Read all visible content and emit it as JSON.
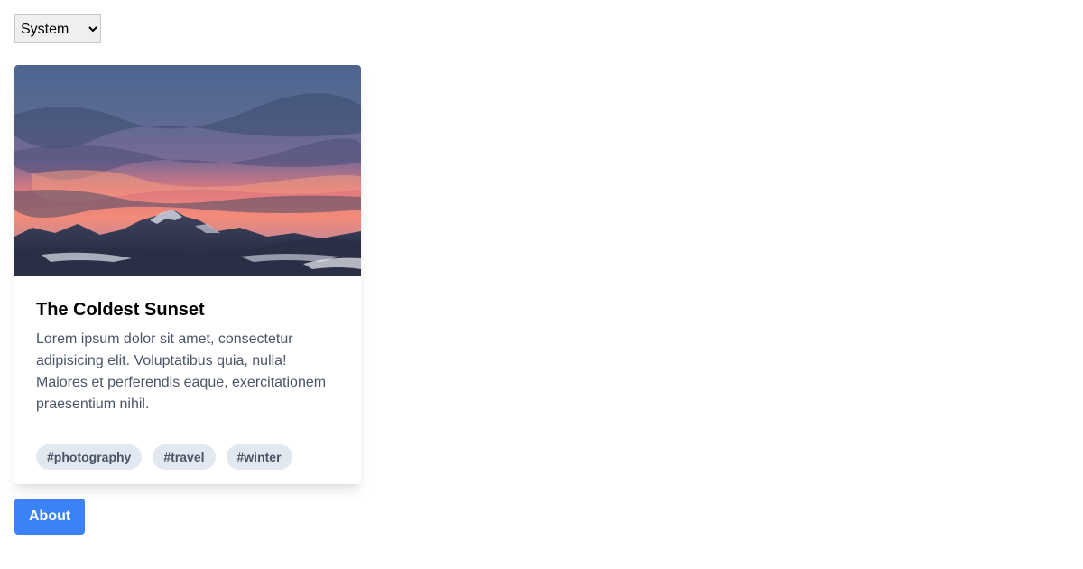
{
  "theme_select": {
    "selected": "System",
    "options": [
      "System"
    ]
  },
  "card": {
    "image": "mountain-sunset-photo",
    "title": "The Coldest Sunset",
    "text": "Lorem ipsum dolor sit amet, consectetur adipisicing elit. Voluptatibus quia, nulla! Maiores et perferendis eaque, exercitationem praesentium nihil.",
    "tags": [
      "#photography",
      "#travel",
      "#winter"
    ]
  },
  "about_button": {
    "label": "About",
    "color": "#3b82f6"
  }
}
